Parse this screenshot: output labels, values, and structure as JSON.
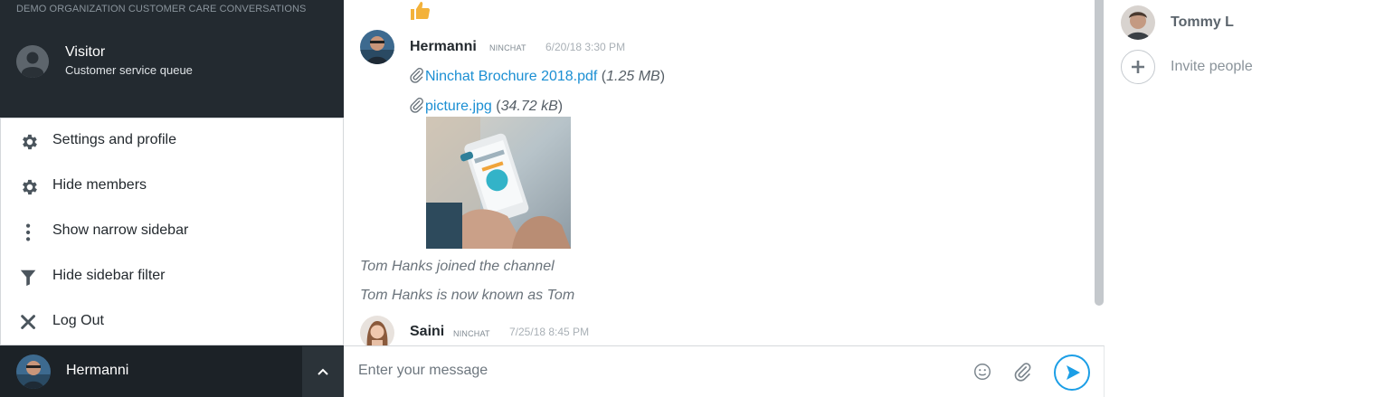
{
  "sidebar": {
    "org_title": "DEMO ORGANIZATION CUSTOMER CARE CONVERSATIONS",
    "visitor": {
      "name": "Visitor",
      "queue": "Customer service queue"
    }
  },
  "menu": {
    "items": [
      {
        "label": "Settings and profile",
        "icon": "gear-icon"
      },
      {
        "label": "Hide members",
        "icon": "gear-icon"
      },
      {
        "label": "Show narrow sidebar",
        "icon": "vertical-dots-icon"
      },
      {
        "label": "Hide sidebar filter",
        "icon": "filter-icon"
      },
      {
        "label": "Log Out",
        "icon": "close-icon"
      }
    ]
  },
  "user_bar": {
    "name": "Hermanni"
  },
  "chat": {
    "messages": [
      {
        "author": "Hermanni",
        "badge": "NINCHAT",
        "time": "6/20/18 3:30 PM",
        "attachments": [
          {
            "name": "Ninchat Brochure 2018.pdf",
            "size": "1.25 MB"
          },
          {
            "name": "picture.jpg",
            "size": "34.72 kB"
          }
        ]
      },
      {
        "author": "Saini",
        "badge": "NINCHAT",
        "time": "7/25/18 8:45 PM"
      }
    ],
    "system": [
      "Tom Hanks joined the channel",
      "Tom Hanks is now known as Tom"
    ]
  },
  "composer": {
    "placeholder": "Enter your message"
  },
  "members": {
    "list": [
      {
        "name": "Tommy L"
      }
    ],
    "invite_label": "Invite people"
  },
  "colors": {
    "sidebar_bg": "#232a30",
    "link": "#1b8fd3",
    "send_accent": "#1b9ee6"
  }
}
